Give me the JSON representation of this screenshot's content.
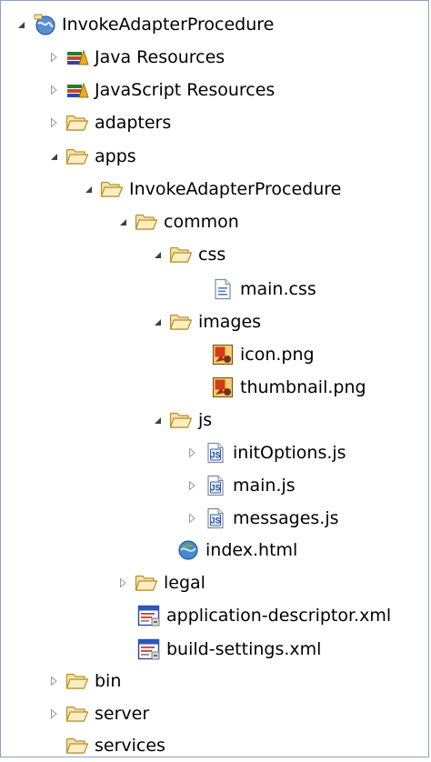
{
  "project_tree": {
    "root": "InvokeAdapterProcedure",
    "java_resources": "Java Resources",
    "javascript_resources": "JavaScript Resources",
    "adapters": "adapters",
    "apps": "apps",
    "app_folder": "InvokeAdapterProcedure",
    "common": "common",
    "css": "css",
    "main_css": "main.css",
    "images": "images",
    "icon_png": "icon.png",
    "thumbnail_png": "thumbnail.png",
    "js": "js",
    "init_options_js": "initOptions.js",
    "main_js": "main.js",
    "messages_js": "messages.js",
    "index_html": "index.html",
    "legal": "legal",
    "application_descriptor_xml": "application-descriptor.xml",
    "build_settings_xml": "build-settings.xml",
    "bin": "bin",
    "server": "server",
    "services": "services"
  },
  "colors": {
    "folder_fill": "#f6e4a8",
    "folder_stroke": "#b98d2c",
    "toggle_expanded": "#404040",
    "toggle_collapsed": "#9a9a9a",
    "frame_border": "#8da2c4"
  }
}
